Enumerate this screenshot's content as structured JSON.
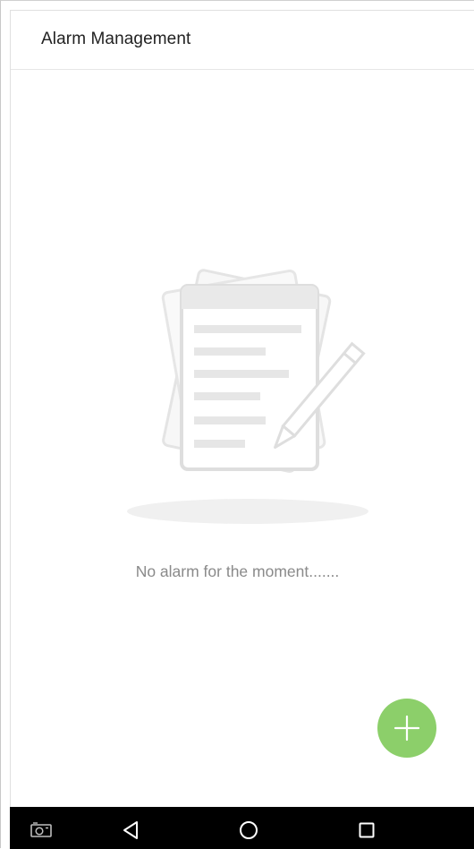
{
  "header": {
    "title": "Alarm Management"
  },
  "empty_state": {
    "icon": "document-edit-icon",
    "message": "No alarm for the moment......."
  },
  "fab": {
    "icon": "plus-icon",
    "color": "#8ccf6a"
  },
  "navbar": {
    "items": [
      {
        "icon": "screenshot-icon"
      },
      {
        "icon": "back-icon"
      },
      {
        "icon": "home-icon"
      },
      {
        "icon": "recents-icon"
      }
    ]
  }
}
